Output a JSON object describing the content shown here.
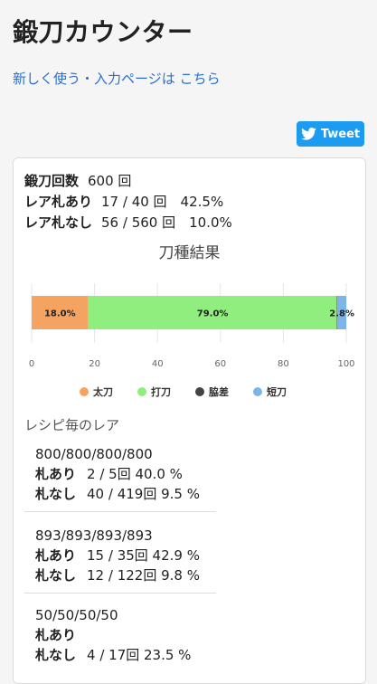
{
  "page": {
    "title": "鍛刀カウンター",
    "new_link": "新しく使う・入力ページは こちら"
  },
  "tweet": {
    "label": "Tweet"
  },
  "stats": {
    "total_label": "鍛刀回数",
    "total_value": "600 回",
    "with_rare_label": "レア札あり",
    "with_rare_value": "17 / 40 回　42.5%",
    "without_rare_label": "レア札なし",
    "without_rare_value": "56 / 560 回　10.0%"
  },
  "chart_data": {
    "type": "bar",
    "orientation": "horizontal-stacked",
    "title": "刀種結果",
    "series": [
      {
        "name": "太刀",
        "value": 18.0,
        "label": "18.0%",
        "color": "#f4a460"
      },
      {
        "name": "打刀",
        "value": 79.0,
        "label": "79.0%",
        "color": "#90ee7e"
      },
      {
        "name": "脇差",
        "value": 0.2,
        "label": "",
        "color": "#444444"
      },
      {
        "name": "短刀",
        "value": 2.8,
        "label": "2.8%",
        "color": "#7cb5ec"
      }
    ],
    "xlim": [
      0,
      100
    ],
    "xticks": [
      "0",
      "20",
      "40",
      "60",
      "80",
      "100"
    ],
    "grid": true,
    "legend_position": "bottom"
  },
  "recipes_section": {
    "title": "レシピ毎のレア"
  },
  "recipes": [
    {
      "name": "800/800/800/800",
      "with_label": "札あり",
      "with_value": "2 / 5回 40.0 %",
      "without_label": "札なし",
      "without_value": "40 / 419回 9.5 %"
    },
    {
      "name": "893/893/893/893",
      "with_label": "札あり",
      "with_value": "15 / 35回 42.9 %",
      "without_label": "札なし",
      "without_value": "12 / 122回 9.8 %"
    },
    {
      "name": "50/50/50/50",
      "with_label": "札あり",
      "with_value": "",
      "without_label": "札なし",
      "without_value": "4 / 17回 23.5 %"
    }
  ]
}
